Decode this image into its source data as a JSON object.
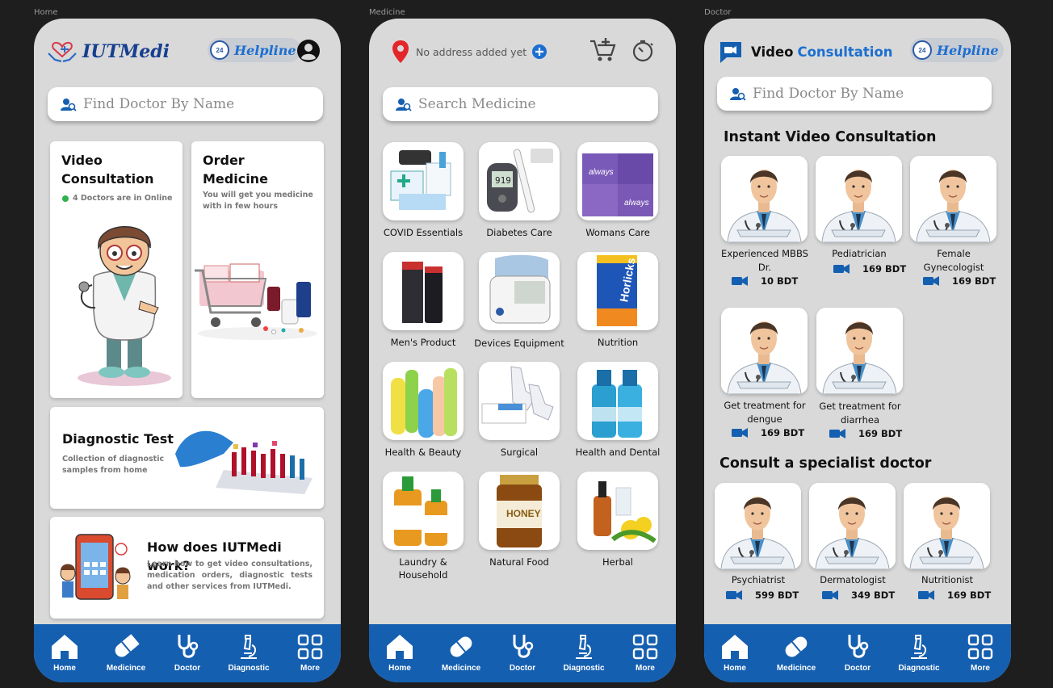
{
  "frames": {
    "home": "Home",
    "medicine": "Medicine",
    "doctor": "Doctor"
  },
  "brand": {
    "logo_text": "IUTMedi"
  },
  "helpline": {
    "label": "Helpline",
    "badge": "24"
  },
  "nav": [
    {
      "label": "Home",
      "icon": "home-icon"
    },
    {
      "label": "Medicince",
      "icon": "pill-icon"
    },
    {
      "label": "Doctor",
      "icon": "stethoscope-icon"
    },
    {
      "label": "Diagnostic",
      "icon": "microscope-icon"
    },
    {
      "label": "More",
      "icon": "grid-icon"
    }
  ],
  "home": {
    "search_placeholder": "Find Doctor By Name",
    "video": {
      "title_line1": "Video",
      "title_line2": "Consultation",
      "online": "4 Doctors are in Online"
    },
    "order": {
      "title_line1": "Order",
      "title_line2": "Medicine",
      "subtitle": "You will get you medicine with in few hours"
    },
    "diagnostic": {
      "title": "Diagnostic Test",
      "subtitle": "Collection of diagnostic samples from home"
    },
    "how": {
      "title": "How does IUTMedi work?",
      "text": "Learn how to get video consultations, medication orders, diagnostic tests and other services from IUTMedi."
    }
  },
  "medicine": {
    "address": "No address added yet",
    "search_placeholder": "Search Medicine",
    "categories": [
      "COVID Essentials",
      "Diabetes Care",
      "Womans Care",
      "Men's Product",
      "Devices Equipment",
      "Nutrition",
      "Health & Beauty",
      "Surgical",
      "Health and Dental",
      "Laundry & Household",
      "Natural Food",
      "Herbal"
    ]
  },
  "doctor": {
    "title_part1": "Video",
    "title_part2": "Consultation",
    "search_placeholder": "Find Doctor By Name",
    "instant_title": "Instant Video Consultation",
    "instant": [
      {
        "name": "Experienced MBBS Dr.",
        "fee": "10 BDT"
      },
      {
        "name": "Pediatrician",
        "fee": "169 BDT"
      },
      {
        "name": "Female Gynecologist",
        "fee": "169 BDT"
      },
      {
        "name": "Get treatment for dengue",
        "fee": "169 BDT"
      },
      {
        "name": "Get treatment for diarrhea",
        "fee": "169 BDT"
      }
    ],
    "specialist_title": "Consult a specialist doctor",
    "specialist": [
      {
        "name": "Psychiatrist",
        "fee": "599 BDT"
      },
      {
        "name": "Dermatologist",
        "fee": "349 BDT"
      },
      {
        "name": "Nutritionist",
        "fee": "169 BDT"
      }
    ]
  },
  "colors": {
    "primary": "#155fb0",
    "accent": "#1b6fd0",
    "online": "#2fb24c",
    "phone_bg": "#d9d9d9"
  }
}
